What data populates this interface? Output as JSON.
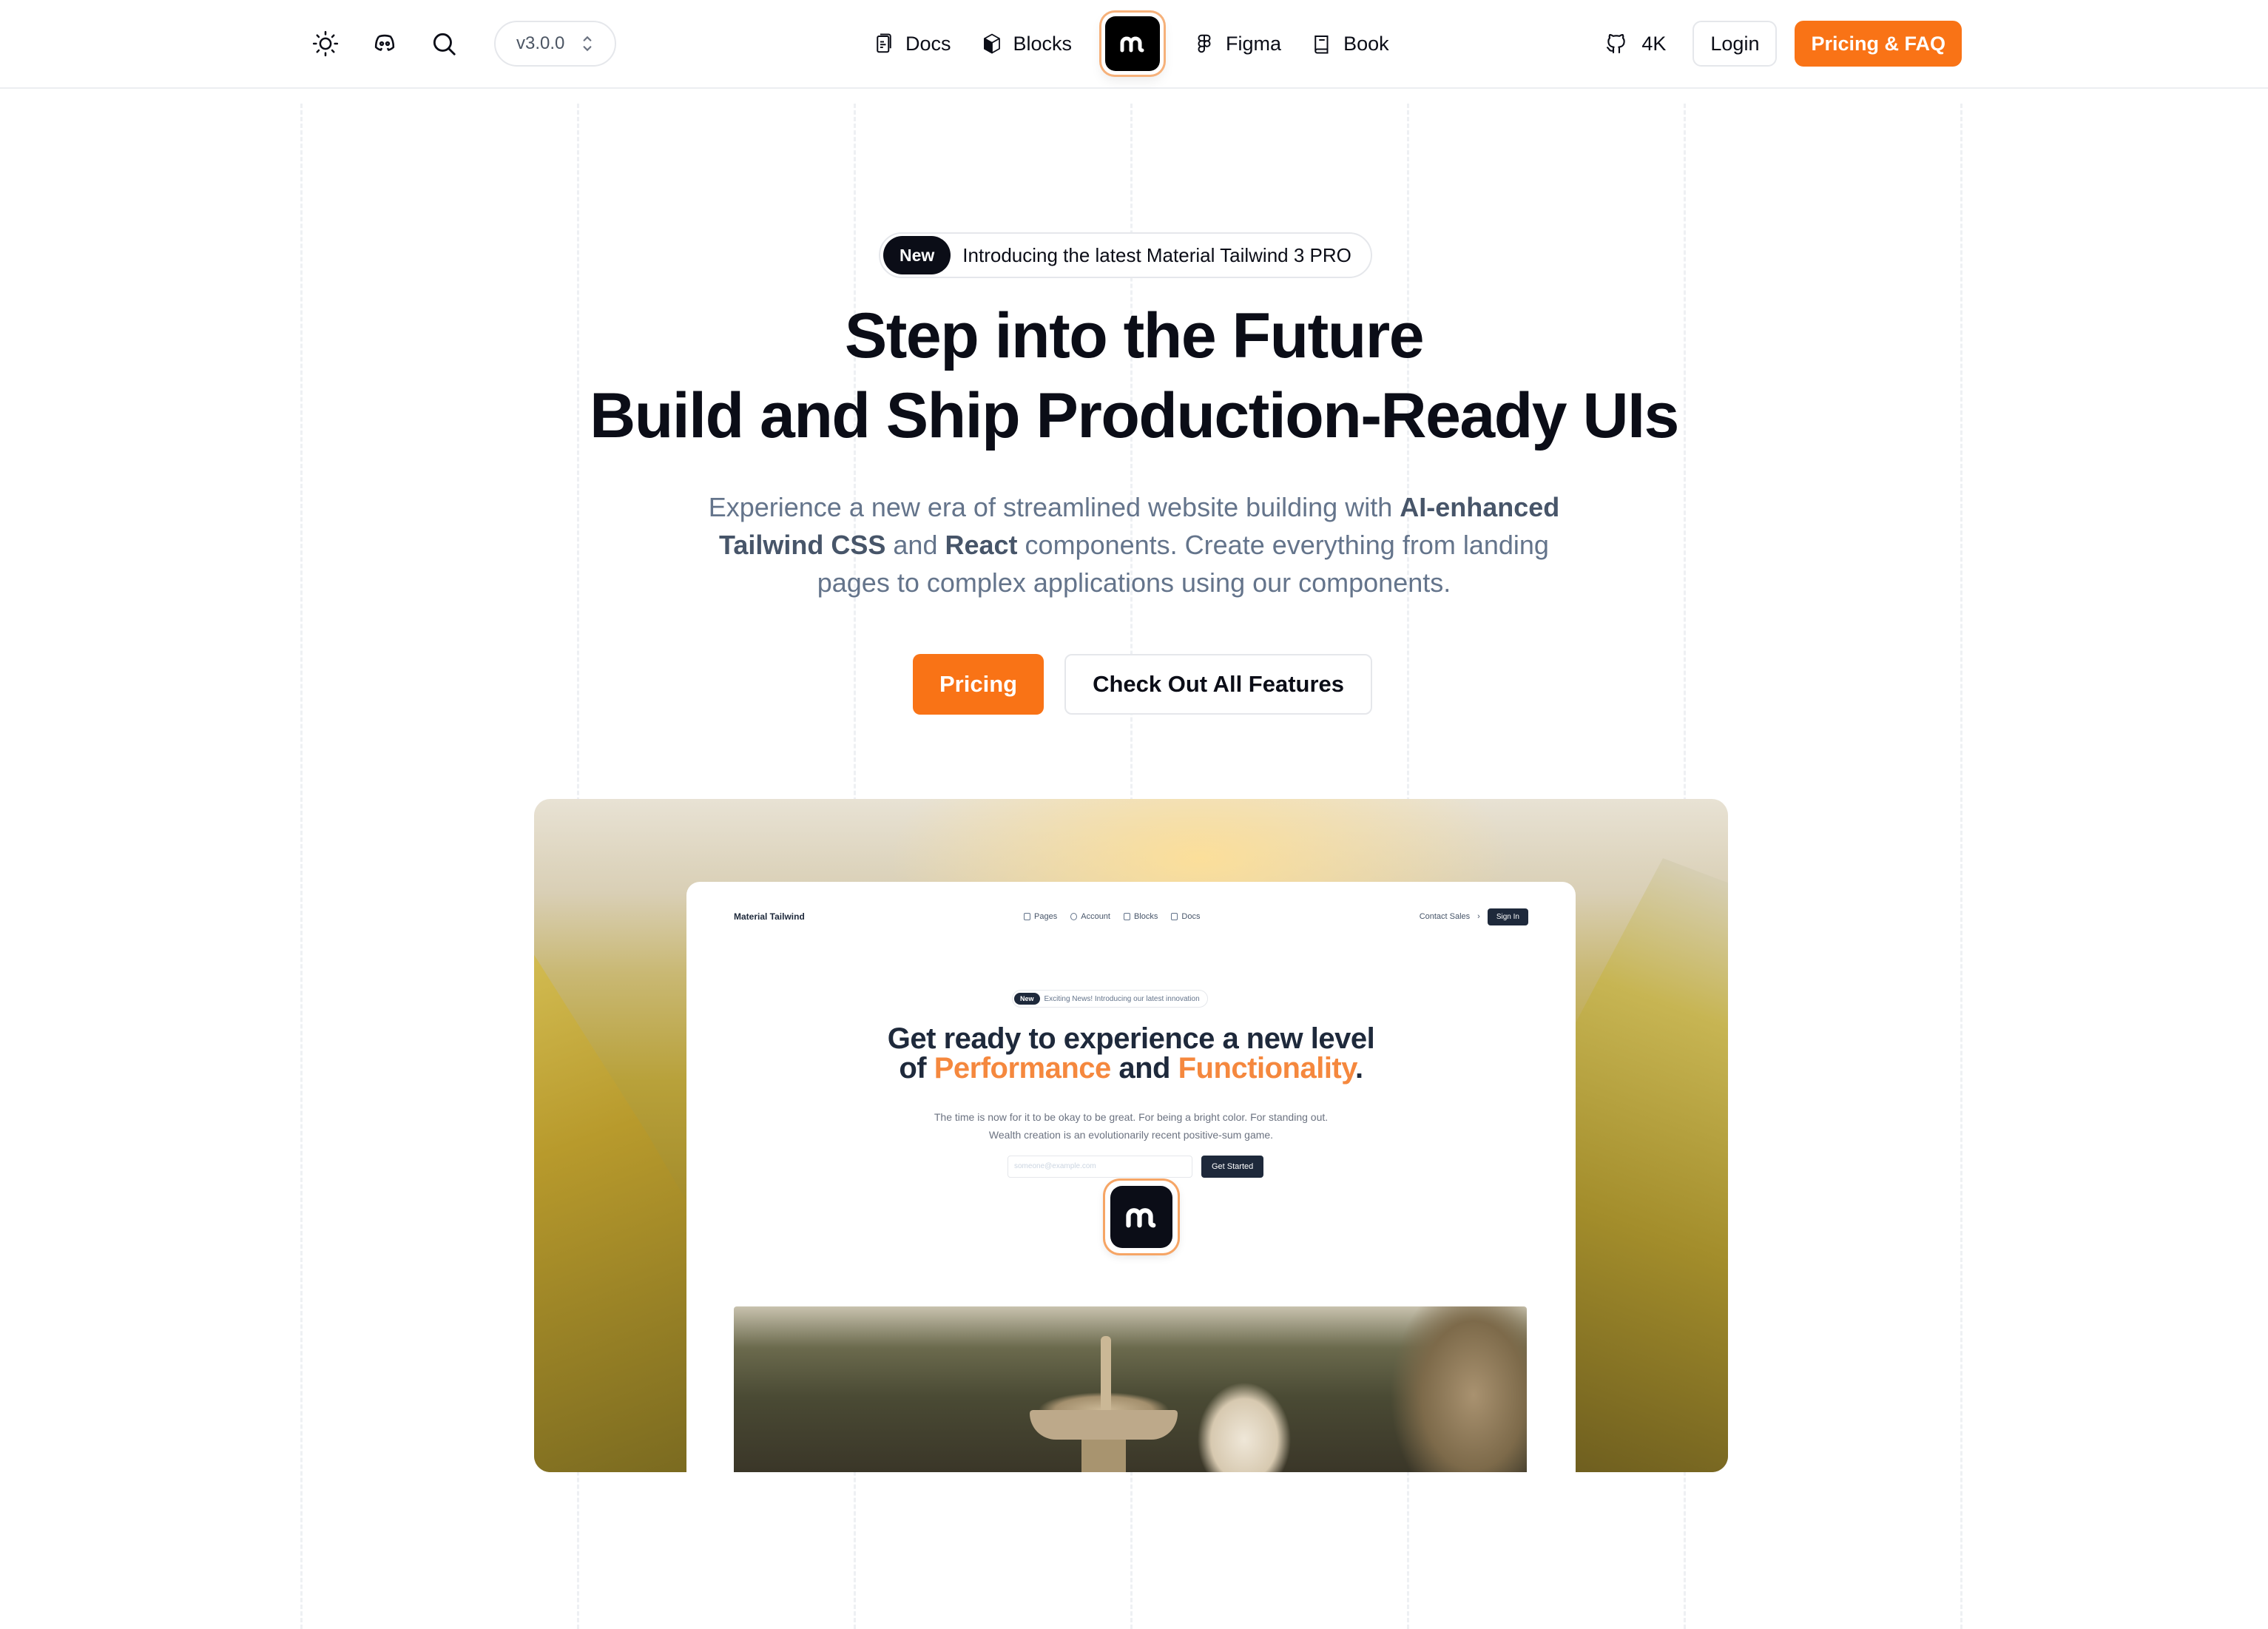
{
  "navbar": {
    "left": {
      "theme_toggle_icon": "sun-icon",
      "discord_icon": "discord-icon",
      "search_icon": "search-icon",
      "version": "v3.0.0"
    },
    "center": {
      "links": [
        {
          "label": "Docs",
          "icon": "document-icon"
        },
        {
          "label": "Blocks",
          "icon": "cube-icon"
        },
        {
          "label": "Figma",
          "icon": "figma-icon"
        },
        {
          "label": "Book",
          "icon": "book-icon"
        }
      ],
      "logo_icon": "material-tailwind-logo"
    },
    "right": {
      "github_stars": "4K",
      "login_label": "Login",
      "pricing_faq_label": "Pricing & FAQ"
    }
  },
  "hero": {
    "announcement": {
      "badge": "New",
      "text": "Introducing the latest Material Tailwind 3 PRO"
    },
    "title_line1": "Step into the Future",
    "title_line2": "Build and Ship Production-Ready UIs",
    "subtitle": {
      "part1": "Experience a new era of streamlined website building with ",
      "bold1": "AI-enhanced Tailwind CSS",
      "part2": " and ",
      "bold2": "React",
      "part3": " components. Create everything from landing pages to complex applications using our components."
    },
    "primary_cta": "Pricing",
    "secondary_cta": "Check Out All Features"
  },
  "showcase": {
    "mock_nav": {
      "brand": "Material Tailwind",
      "links": [
        "Pages",
        "Account",
        "Blocks",
        "Docs"
      ],
      "contact": "Contact Sales",
      "signin": "Sign In"
    },
    "mock_badge": {
      "label": "New",
      "text": "Exciting News! Introducing our latest innovation"
    },
    "mock_title": {
      "line1": "Get ready to experience a new level",
      "of": "of ",
      "accent1": "Performance",
      "and": " and ",
      "accent2": "Functionality",
      "period": "."
    },
    "mock_sub_line1": "The time is now for it to be okay to be great. For being a bright color. For standing out.",
    "mock_sub_line2": "Wealth creation is an evolutionarily recent positive-sum game.",
    "mock_input_placeholder": "someone@example.com",
    "mock_button": "Get Started"
  },
  "colors": {
    "accent": "#f97316",
    "dark": "#0b0d17",
    "muted_text": "#64748b"
  }
}
